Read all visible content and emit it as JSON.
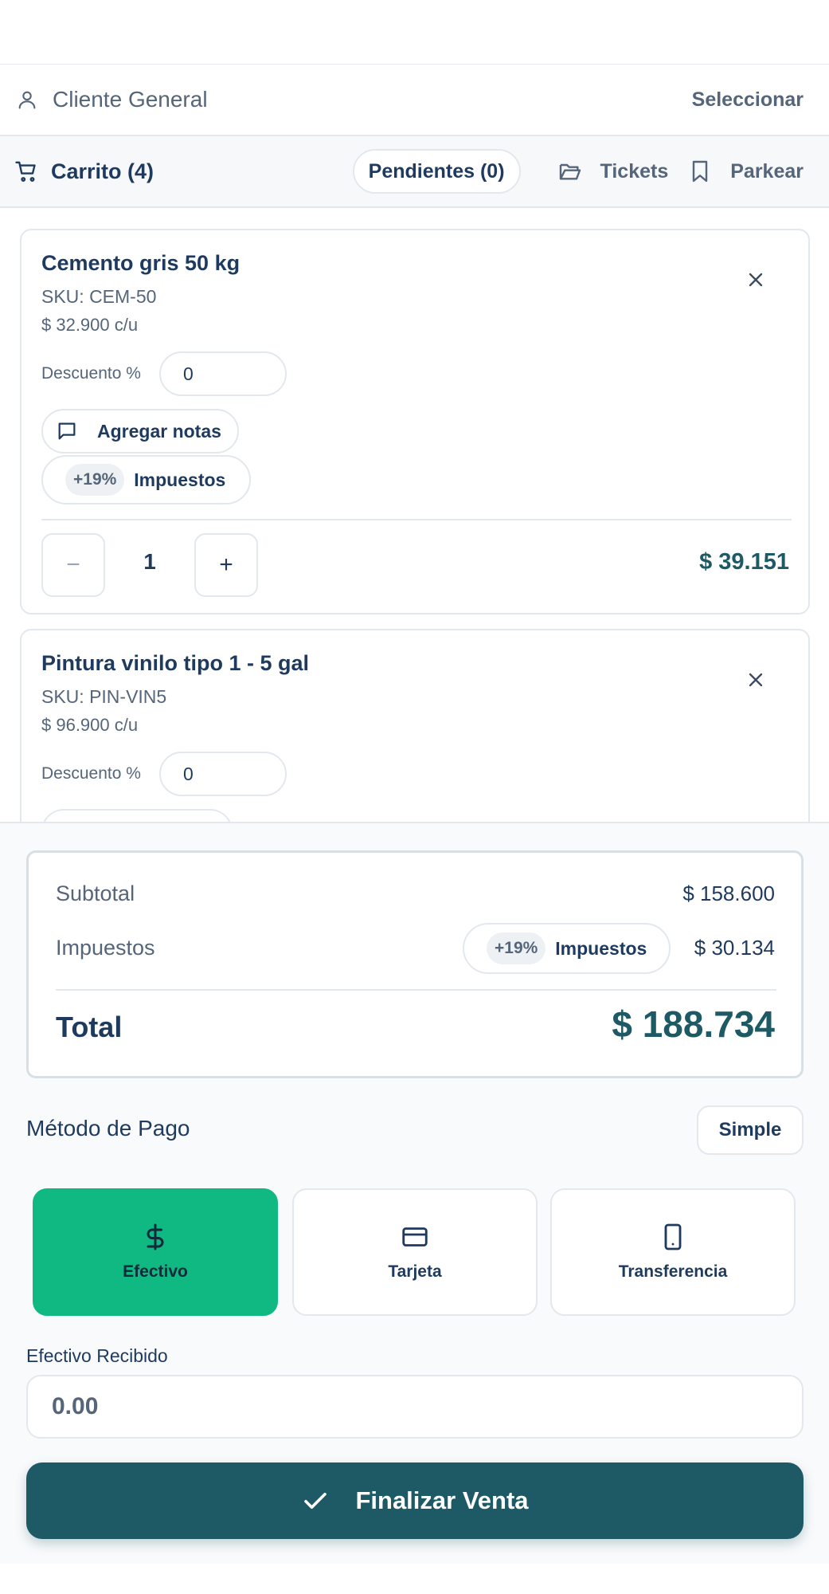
{
  "client": {
    "name": "Cliente General",
    "select_label": "Seleccionar"
  },
  "cart": {
    "title": "Carrito (4)",
    "pending_label": "Pendientes (0)",
    "tickets_label": "Tickets",
    "park_label": "Parkear"
  },
  "items": [
    {
      "name": "Cemento gris 50 kg",
      "sku": "SKU: CEM-50",
      "unit_price": "$ 32.900 c/u",
      "discount_label": "Descuento %",
      "discount_value": "0",
      "notes_label": "Agregar notas",
      "tax_badge": "+19%",
      "tax_label": "Impuestos",
      "qty_minus": "−",
      "quantity": "1",
      "qty_plus": "+",
      "line_total": "$ 39.151"
    },
    {
      "name": "Pintura vinilo tipo 1 - 5 gal",
      "sku": "SKU: PIN-VIN5",
      "unit_price": "$ 96.900 c/u",
      "discount_label": "Descuento %",
      "discount_value": "0"
    }
  ],
  "summary": {
    "subtotal_label": "Subtotal",
    "subtotal_value": "$ 158.600",
    "tax_label": "Impuestos",
    "tax_badge": "+19%",
    "tax_pill_label": "Impuestos",
    "tax_value": "$ 30.134",
    "total_label": "Total",
    "total_value": "$ 188.734"
  },
  "payment": {
    "title": "Método de Pago",
    "mode_label": "Simple",
    "methods": [
      {
        "label": "Efectivo",
        "icon": "dollar-icon",
        "active": true
      },
      {
        "label": "Tarjeta",
        "icon": "credit-card-icon",
        "active": false
      },
      {
        "label": "Transferencia",
        "icon": "smartphone-icon",
        "active": false
      }
    ],
    "cash_label": "Efectivo Recibido",
    "cash_placeholder": "0.00",
    "finish_label": "Finalizar Venta"
  },
  "colors": {
    "accent": "#1d5a66",
    "active_method": "#10b981",
    "text_primary": "#1e3a5f",
    "text_secondary": "#55657a"
  }
}
